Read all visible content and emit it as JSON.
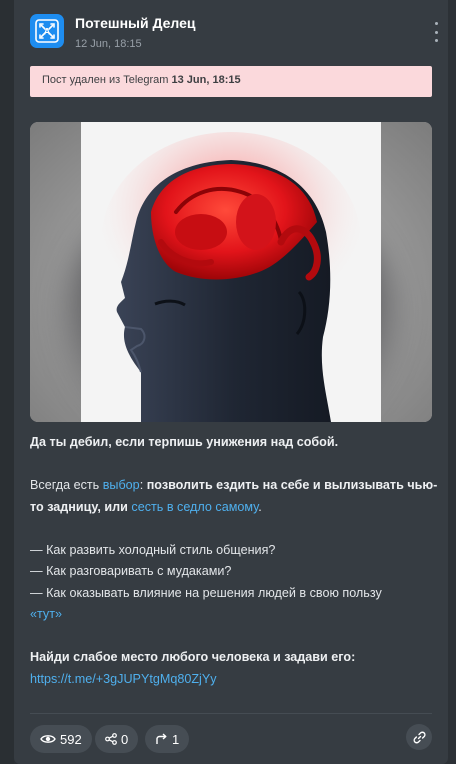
{
  "channel": {
    "name": "Потешный Делец",
    "date": "12 Jun, 18:15",
    "avatar_icon": "channel-avatar-icon",
    "avatar_color": "#1e8df0"
  },
  "banner": {
    "text": "Пост удален из Telegram ",
    "date": "13 Jun, 18:15"
  },
  "media": {
    "description_icon": "post-image"
  },
  "post": {
    "line1": "Да ты дебил, если терпишь унижения над собой.",
    "p2_a": "Всегда есть ",
    "p2_link1": "выбор",
    "p2_b": ": ",
    "p2_bold1": "позволить ездить на себе и вылизывать чью-то задницу, или ",
    "p2_link2": "сесть в седло самому",
    "p2_c": ".",
    "q1": "— Как развить холодный стиль общения?",
    "q2": "— Как разговаривать с мудаками?",
    "q3": "— Как оказывать влияние на решения людей в свою пользу",
    "here_link": "«тут»",
    "cta": "Найди слабое место любого человека и задави его:",
    "url": "https://t.me/+3gJUPYtgMq80ZjYy"
  },
  "stats": {
    "views": "592",
    "shares": "0",
    "forwards": "1"
  },
  "colors": {
    "link": "#4fb0ee",
    "banner_bg": "#fbd9dc",
    "card_bg": "#363c42"
  }
}
